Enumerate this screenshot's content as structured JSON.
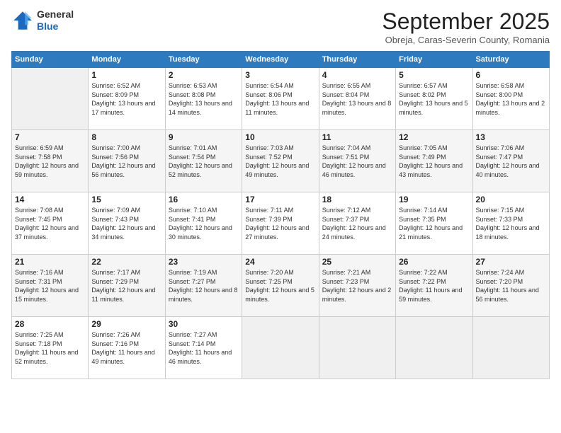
{
  "header": {
    "logo_line1": "General",
    "logo_line2": "Blue",
    "month_title": "September 2025",
    "location": "Obreja, Caras-Severin County, Romania"
  },
  "days_of_week": [
    "Sunday",
    "Monday",
    "Tuesday",
    "Wednesday",
    "Thursday",
    "Friday",
    "Saturday"
  ],
  "weeks": [
    [
      null,
      {
        "day": 1,
        "sunrise": "6:52 AM",
        "sunset": "8:09 PM",
        "daylight": "13 hours and 17 minutes."
      },
      {
        "day": 2,
        "sunrise": "6:53 AM",
        "sunset": "8:08 PM",
        "daylight": "13 hours and 14 minutes."
      },
      {
        "day": 3,
        "sunrise": "6:54 AM",
        "sunset": "8:06 PM",
        "daylight": "13 hours and 11 minutes."
      },
      {
        "day": 4,
        "sunrise": "6:55 AM",
        "sunset": "8:04 PM",
        "daylight": "13 hours and 8 minutes."
      },
      {
        "day": 5,
        "sunrise": "6:57 AM",
        "sunset": "8:02 PM",
        "daylight": "13 hours and 5 minutes."
      },
      {
        "day": 6,
        "sunrise": "6:58 AM",
        "sunset": "8:00 PM",
        "daylight": "13 hours and 2 minutes."
      }
    ],
    [
      {
        "day": 7,
        "sunrise": "6:59 AM",
        "sunset": "7:58 PM",
        "daylight": "12 hours and 59 minutes."
      },
      {
        "day": 8,
        "sunrise": "7:00 AM",
        "sunset": "7:56 PM",
        "daylight": "12 hours and 56 minutes."
      },
      {
        "day": 9,
        "sunrise": "7:01 AM",
        "sunset": "7:54 PM",
        "daylight": "12 hours and 52 minutes."
      },
      {
        "day": 10,
        "sunrise": "7:03 AM",
        "sunset": "7:52 PM",
        "daylight": "12 hours and 49 minutes."
      },
      {
        "day": 11,
        "sunrise": "7:04 AM",
        "sunset": "7:51 PM",
        "daylight": "12 hours and 46 minutes."
      },
      {
        "day": 12,
        "sunrise": "7:05 AM",
        "sunset": "7:49 PM",
        "daylight": "12 hours and 43 minutes."
      },
      {
        "day": 13,
        "sunrise": "7:06 AM",
        "sunset": "7:47 PM",
        "daylight": "12 hours and 40 minutes."
      }
    ],
    [
      {
        "day": 14,
        "sunrise": "7:08 AM",
        "sunset": "7:45 PM",
        "daylight": "12 hours and 37 minutes."
      },
      {
        "day": 15,
        "sunrise": "7:09 AM",
        "sunset": "7:43 PM",
        "daylight": "12 hours and 34 minutes."
      },
      {
        "day": 16,
        "sunrise": "7:10 AM",
        "sunset": "7:41 PM",
        "daylight": "12 hours and 30 minutes."
      },
      {
        "day": 17,
        "sunrise": "7:11 AM",
        "sunset": "7:39 PM",
        "daylight": "12 hours and 27 minutes."
      },
      {
        "day": 18,
        "sunrise": "7:12 AM",
        "sunset": "7:37 PM",
        "daylight": "12 hours and 24 minutes."
      },
      {
        "day": 19,
        "sunrise": "7:14 AM",
        "sunset": "7:35 PM",
        "daylight": "12 hours and 21 minutes."
      },
      {
        "day": 20,
        "sunrise": "7:15 AM",
        "sunset": "7:33 PM",
        "daylight": "12 hours and 18 minutes."
      }
    ],
    [
      {
        "day": 21,
        "sunrise": "7:16 AM",
        "sunset": "7:31 PM",
        "daylight": "12 hours and 15 minutes."
      },
      {
        "day": 22,
        "sunrise": "7:17 AM",
        "sunset": "7:29 PM",
        "daylight": "12 hours and 11 minutes."
      },
      {
        "day": 23,
        "sunrise": "7:19 AM",
        "sunset": "7:27 PM",
        "daylight": "12 hours and 8 minutes."
      },
      {
        "day": 24,
        "sunrise": "7:20 AM",
        "sunset": "7:25 PM",
        "daylight": "12 hours and 5 minutes."
      },
      {
        "day": 25,
        "sunrise": "7:21 AM",
        "sunset": "7:23 PM",
        "daylight": "12 hours and 2 minutes."
      },
      {
        "day": 26,
        "sunrise": "7:22 AM",
        "sunset": "7:22 PM",
        "daylight": "11 hours and 59 minutes."
      },
      {
        "day": 27,
        "sunrise": "7:24 AM",
        "sunset": "7:20 PM",
        "daylight": "11 hours and 56 minutes."
      }
    ],
    [
      {
        "day": 28,
        "sunrise": "7:25 AM",
        "sunset": "7:18 PM",
        "daylight": "11 hours and 52 minutes."
      },
      {
        "day": 29,
        "sunrise": "7:26 AM",
        "sunset": "7:16 PM",
        "daylight": "11 hours and 49 minutes."
      },
      {
        "day": 30,
        "sunrise": "7:27 AM",
        "sunset": "7:14 PM",
        "daylight": "11 hours and 46 minutes."
      },
      null,
      null,
      null,
      null
    ]
  ]
}
